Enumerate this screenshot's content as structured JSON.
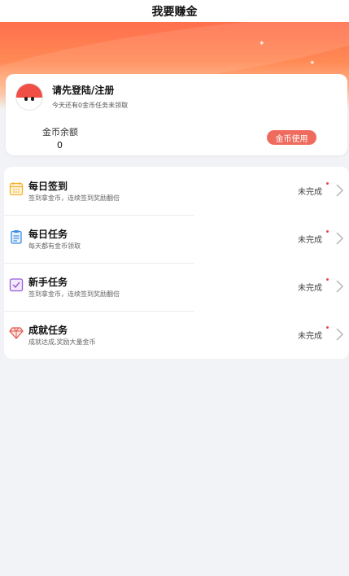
{
  "header": {
    "title": "我要赚金"
  },
  "account": {
    "login_prompt": "请先登陆/注册",
    "unclaimed_note": "今天还有0金币任务未领取",
    "balance_label": "金币余额",
    "balance_value": "0",
    "use_coins_label": "金币使用"
  },
  "tasks": [
    {
      "title": "每日签到",
      "subtitle": "签到拿金币，连续签到奖励翻倍",
      "status": "未完成",
      "icon": "calendar-icon"
    },
    {
      "title": "每日任务",
      "subtitle": "每天都有金币领取",
      "status": "未完成",
      "icon": "clipboard-icon"
    },
    {
      "title": "新手任务",
      "subtitle": "签到拿金币，连续签到奖励翻倍",
      "status": "未完成",
      "icon": "checkbox-icon"
    },
    {
      "title": "成就任务",
      "subtitle": "成就达成,奖励大量金币",
      "status": "未完成",
      "icon": "diamond-icon"
    }
  ],
  "colors": {
    "accent": "#ff6f4d",
    "button": "#ef6b5e",
    "status_dot": "#e44444"
  }
}
